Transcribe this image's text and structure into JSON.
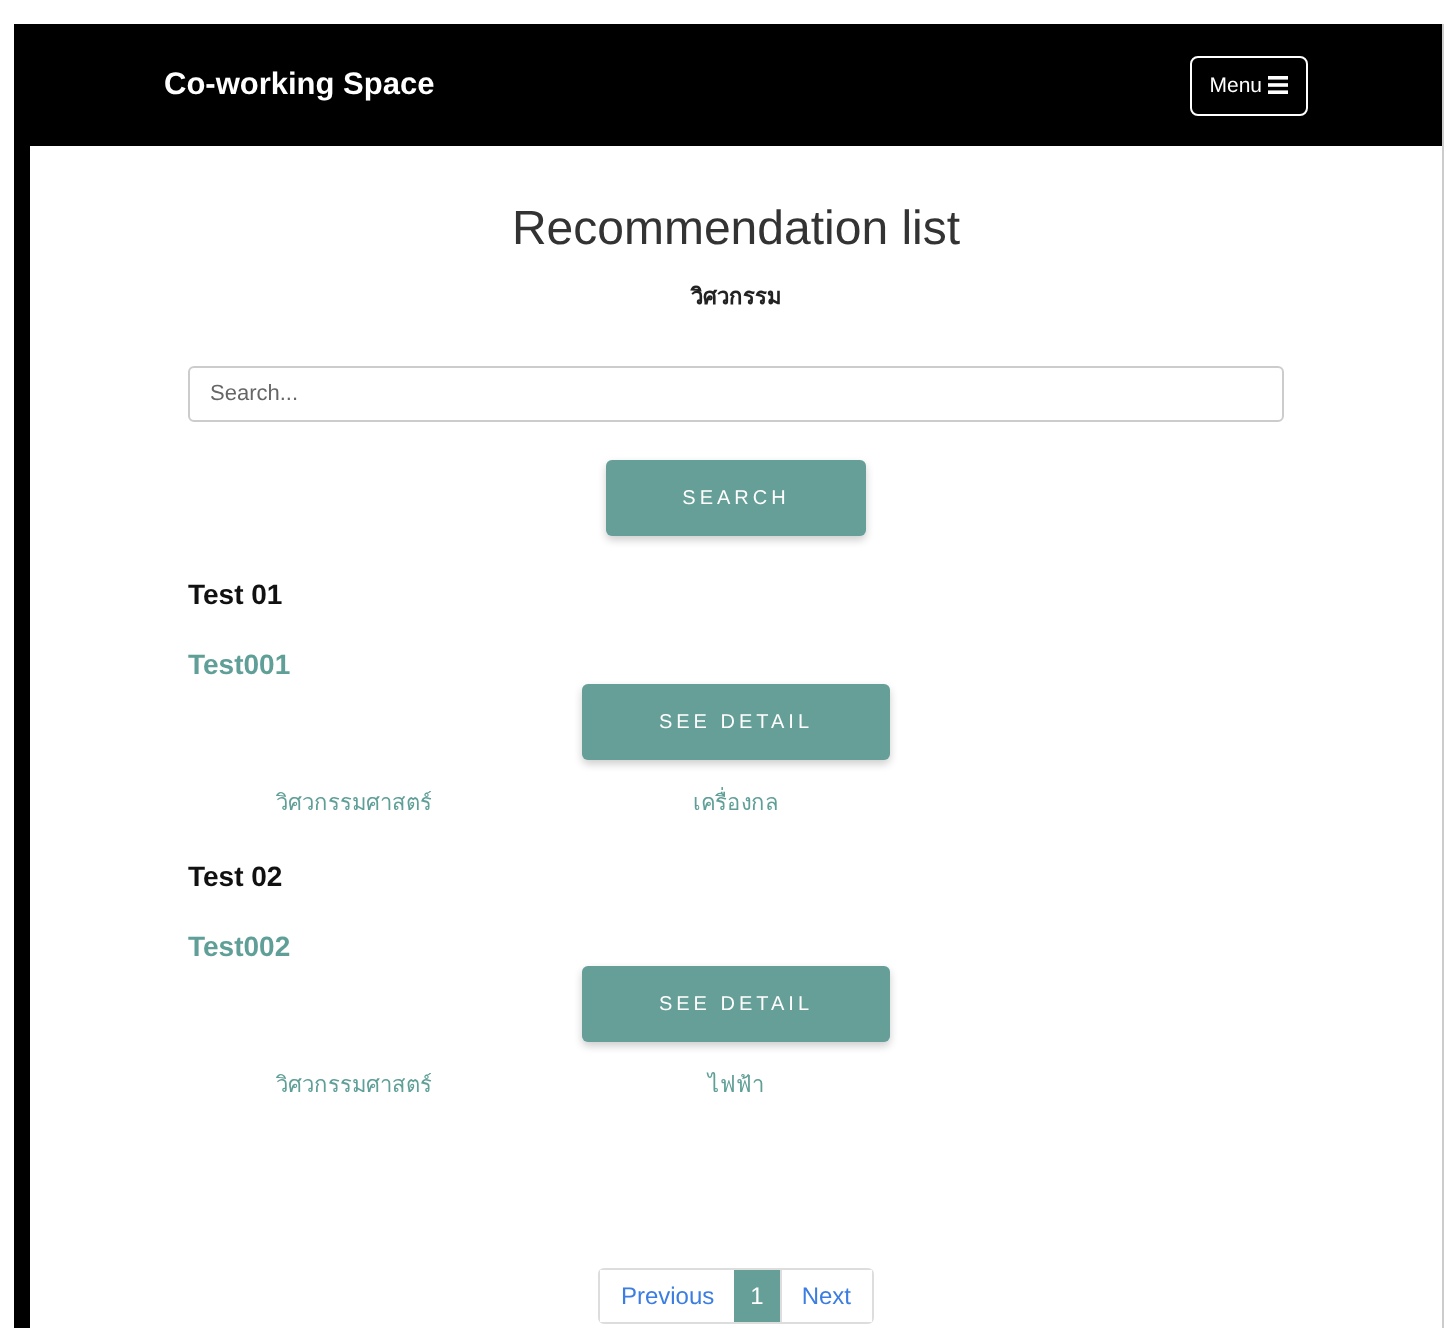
{
  "navbar": {
    "brand": "Co-working Space",
    "menu_button": "Menu"
  },
  "header": {
    "title": "Recommendation list",
    "subtitle": "วิศวกรรม"
  },
  "search": {
    "placeholder": "Search...",
    "button": "SEARCH"
  },
  "items": [
    {
      "heading": "Test 01",
      "name": "Test001",
      "button": "SEE DETAIL",
      "tags": [
        "วิศวกรรมศาสตร์",
        "เครื่องกล"
      ]
    },
    {
      "heading": "Test 02",
      "name": "Test002",
      "button": "SEE DETAIL",
      "tags": [
        "วิศวกรรมศาสตร์",
        "ไฟฟ้า"
      ]
    }
  ],
  "pagination": {
    "previous": "Previous",
    "next": "Next",
    "pages": [
      {
        "label": "1",
        "selected": true
      }
    ]
  }
}
